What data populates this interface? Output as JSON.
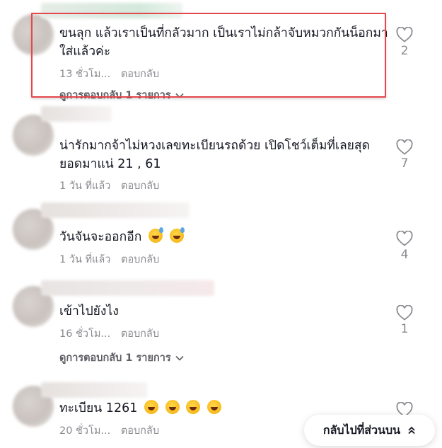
{
  "comments": [
    {
      "text": "ขนลุก แล้วเราเป็นที่กลัวมาก เป็นเราไม่กล้าจับหมวกกันน็อกมาใส่แล้วค่ะ",
      "time": "13 ชั่วโม...",
      "reply": "ตอบกลับ",
      "view_replies": "ดูการตอบกลับ 1 รายการ",
      "likes": "2"
    },
    {
      "text": "น่ารักมากจ้าไม่หวงเลขทะเบียนรถด้วย เปิดโชว์เต็มที่เลยสุดยอดมาแน่ 21 , 61",
      "time": "1 วัน ที่แล้ว",
      "reply": "ตอบกลับ",
      "likes": "7"
    },
    {
      "text": "วันจันจะออกอีก",
      "emojis": [
        "grinning-sweat",
        "grinning-sweat"
      ],
      "time": "1 วัน ที่แล้ว",
      "reply": "ตอบกลับ",
      "likes": "4"
    },
    {
      "text": "เข้าไปยังไง",
      "time": "16 ชั่วโม...",
      "reply": "ตอบกลับ",
      "view_replies": "ดูการตอบกลับ 1 รายการ",
      "likes": "1"
    },
    {
      "text": "ทะเบียน 1261",
      "emojis": [
        "laughing",
        "laughing",
        "laughing",
        "laughing"
      ],
      "time": "20 ชั่วโม...",
      "reply": "ตอบกลับ"
    }
  ],
  "back_to_top": "กลับไปที่ส่วนบน",
  "colors": {
    "highlight": "#e5474b",
    "meta": "#8a8b91",
    "text": "#161823"
  },
  "icons": {
    "like": "heart-outline-icon",
    "expand": "chevron-down-icon",
    "back_to_top": "chevron-double-up-icon"
  }
}
